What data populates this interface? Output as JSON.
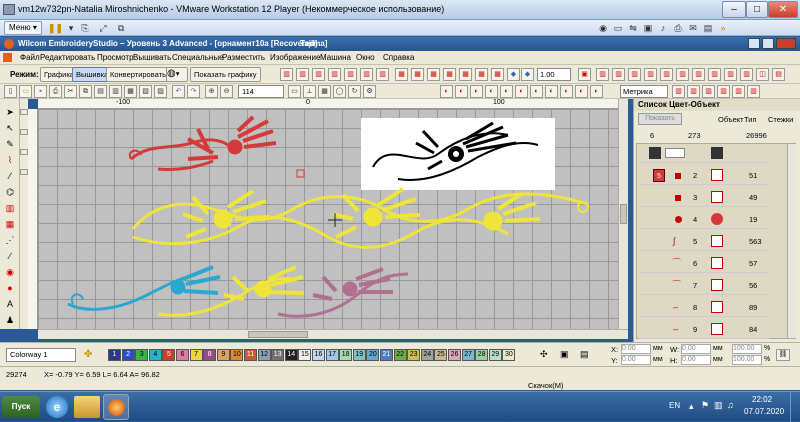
{
  "vm": {
    "title": "vm12w732pn-Natalia Miroshnichenko - VMware Workstation 12 Player (Некоммерческое использование)",
    "menu_label": "Меню",
    "menu_arrow": "▾",
    "minimize": "–",
    "restore": "□",
    "close": "✕"
  },
  "app": {
    "title": "Wilcom EmbroideryStudio – Уровень 3 Advanced - [орнамент10a [Recovered]",
    "machine": "Tajima]"
  },
  "menu": [
    "Файл",
    "Редактировать",
    "Просмотр",
    "Вышивать",
    "Специальные",
    "Разместить",
    "Изображение",
    "Машина",
    "Окно",
    "Справка"
  ],
  "toolbar1": {
    "mode_label": "Режим:",
    "graphic_btn": "Графика",
    "embroidery_btn": "Вышивка",
    "convert_btn": "Конвертировать",
    "show_graphic_btn": "Показать графику",
    "zoom_value": "1.00",
    "dropdown_arrow": "▾"
  },
  "toolbar2": {
    "zoom_value": "114",
    "units_value": "Метрика"
  },
  "ruler": {
    "minus100": "-100",
    "zero": "0",
    "plus100": "100"
  },
  "panel": {
    "title": "Список Цвет-Объект",
    "sub_btn": "Показать",
    "col_object": "Объект",
    "col_type": "Тип",
    "col_stitches": "Стежки",
    "header_counts": {
      "a": "6",
      "b": "273",
      "c": "26996"
    },
    "rows": [
      {
        "idx": "",
        "stitches": ""
      },
      {
        "idx": "2",
        "stitches": "51"
      },
      {
        "idx": "3",
        "stitches": "49"
      },
      {
        "idx": "4",
        "stitches": "19"
      },
      {
        "idx": "5",
        "stitches": "563"
      },
      {
        "idx": "6",
        "stitches": "57"
      },
      {
        "idx": "7",
        "stitches": "56"
      },
      {
        "idx": "8",
        "stitches": "89"
      },
      {
        "idx": "9",
        "stitches": "84"
      }
    ],
    "selected_badge": "5"
  },
  "colorbar": {
    "colorway": "Colorway 1",
    "swatches": [
      {
        "n": "1",
        "color": "#2a3a8a"
      },
      {
        "n": "2",
        "color": "#2c4cc4"
      },
      {
        "n": "3",
        "color": "#38b34a"
      },
      {
        "n": "4",
        "color": "#2bb0d0"
      },
      {
        "n": "5",
        "color": "#d43a2a"
      },
      {
        "n": "6",
        "color": "#e07aa8"
      },
      {
        "n": "7",
        "color": "#e8d840"
      },
      {
        "n": "8",
        "color": "#9a4a8a"
      },
      {
        "n": "9",
        "color": "#e0a060"
      },
      {
        "n": "10",
        "color": "#e08830"
      },
      {
        "n": "11",
        "color": "#c85a30"
      },
      {
        "n": "12",
        "color": "#8aa0b0"
      },
      {
        "n": "13",
        "color": "#707070"
      },
      {
        "n": "14",
        "color": "#202020"
      },
      {
        "n": "15",
        "color": "#f0f0f0"
      },
      {
        "n": "16",
        "color": "#c0d8f0"
      },
      {
        "n": "17",
        "color": "#a0c8e8"
      },
      {
        "n": "18",
        "color": "#a8d8b0"
      },
      {
        "n": "19",
        "color": "#80c0c0"
      },
      {
        "n": "20",
        "color": "#60a8d0"
      },
      {
        "n": "21",
        "color": "#4a80c0"
      },
      {
        "n": "22",
        "color": "#6ab04a"
      },
      {
        "n": "23",
        "color": "#c8c050"
      },
      {
        "n": "24",
        "color": "#a0a0a0"
      },
      {
        "n": "25",
        "color": "#c8b890"
      },
      {
        "n": "26",
        "color": "#d8a8b8"
      },
      {
        "n": "27",
        "color": "#78b8d0"
      },
      {
        "n": "28",
        "color": "#9ad0a0"
      },
      {
        "n": "29",
        "color": "#b8e0d0"
      },
      {
        "n": "30",
        "color": "#e8e8c8"
      }
    ],
    "x_label": "X:",
    "y_label": "Y:",
    "w_label": "W:",
    "h_label": "H:",
    "x_value": "0.00",
    "y_value": "0.00",
    "w_value": "0.00",
    "h_value": "0.00",
    "unit": "мм",
    "pct_w": "100.00",
    "pct_h": "100.00",
    "pct": "%"
  },
  "status": {
    "stitches": "29274",
    "coords": "X= -0.79 Y= 6.59 L= 6.64 A= 96.82",
    "download": "Скачок(M)"
  },
  "taskbar": {
    "start": "Пуск",
    "lang": "EN",
    "time": "22:02",
    "date": "07.07.2020"
  },
  "colors": {
    "embroidery_red": "#d43a3a",
    "embroidery_yellow": "#eee43a",
    "embroidery_cyan": "#2aa8d0",
    "embroidery_pink": "#b07090",
    "canvas_bg": "#c0c0c0"
  }
}
